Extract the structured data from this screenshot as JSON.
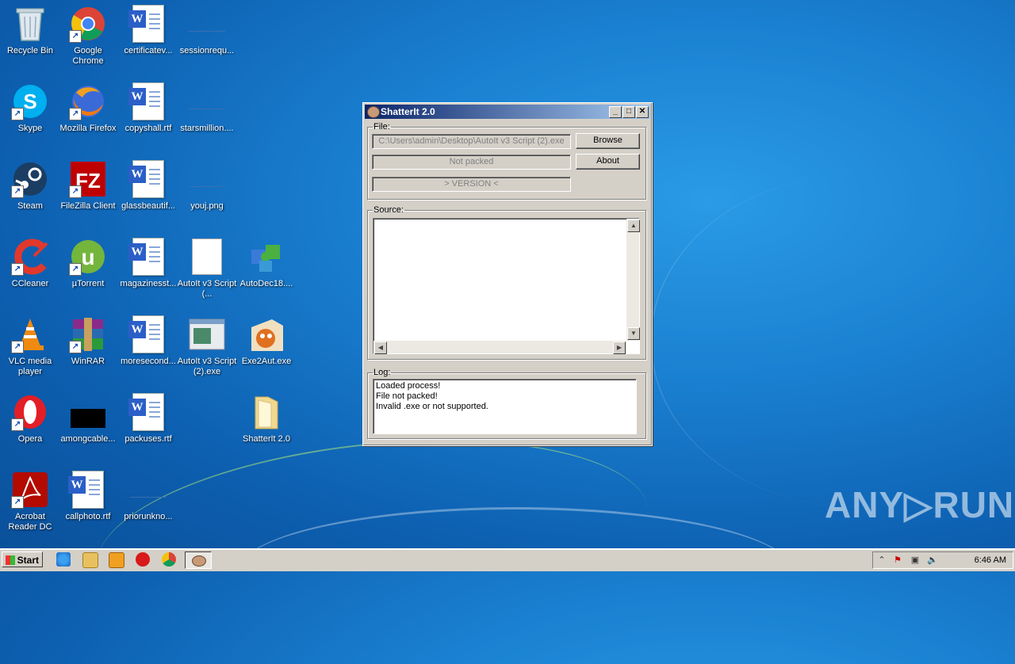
{
  "desktop": {
    "icons": [
      {
        "label": "Recycle Bin"
      },
      {
        "label": "Google Chrome"
      },
      {
        "label": "certificatev..."
      },
      {
        "label": "sessionrequ..."
      },
      {
        "label": "Skype"
      },
      {
        "label": "Mozilla Firefox"
      },
      {
        "label": "copyshall.rtf"
      },
      {
        "label": "starsmillion...."
      },
      {
        "label": "Steam"
      },
      {
        "label": "FileZilla Client"
      },
      {
        "label": "glassbeautif..."
      },
      {
        "label": "youj.png"
      },
      {
        "label": "CCleaner"
      },
      {
        "label": "µTorrent"
      },
      {
        "label": "magazinesst..."
      },
      {
        "label": "AutoIt v3 Script (..."
      },
      {
        "label": "AutoDec18...."
      },
      {
        "label": "VLC media player"
      },
      {
        "label": "WinRAR"
      },
      {
        "label": "moresecond..."
      },
      {
        "label": "AutoIt v3 Script (2).exe"
      },
      {
        "label": "Exe2Aut.exe"
      },
      {
        "label": "Opera"
      },
      {
        "label": "amongcable..."
      },
      {
        "label": "packuses.rtf"
      },
      {
        "label": "ShatterIt 2.0"
      },
      {
        "label": "Acrobat Reader DC"
      },
      {
        "label": "callphoto.rtf"
      },
      {
        "label": "priorunkno..."
      }
    ]
  },
  "window": {
    "title": "ShatterIt 2.0",
    "file_legend": "File:",
    "file_path": "C:\\Users\\admin\\Desktop\\AutoIt v3 Script (2).exe",
    "status": "Not packed",
    "version": "> VERSION <",
    "browse_label": "Browse",
    "about_label": "About",
    "source_legend": "Source:",
    "log_legend": "Log:",
    "log_lines": [
      "Loaded process!",
      "File not packed!",
      "Invalid .exe or not supported."
    ]
  },
  "taskbar": {
    "start_label": "Start",
    "clock": "6:46 AM"
  },
  "watermark": "ANY▷RUN"
}
